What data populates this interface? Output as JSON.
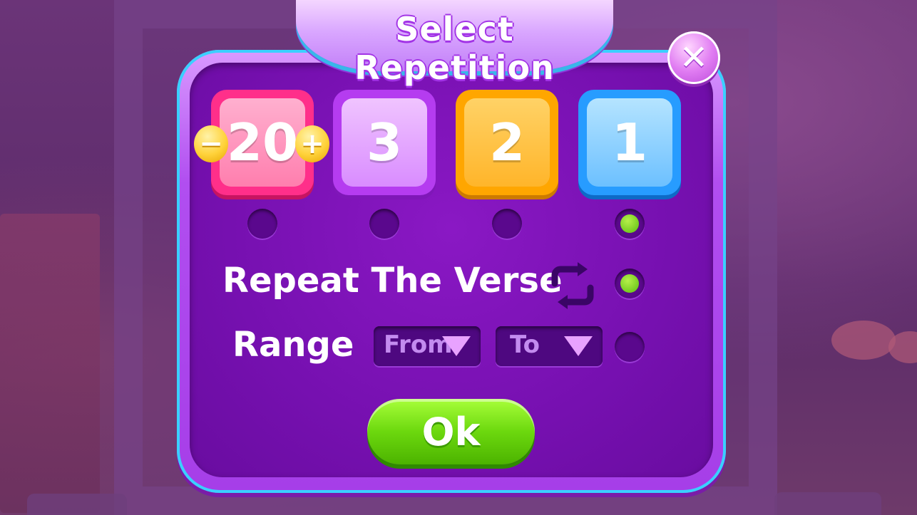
{
  "dialog": {
    "title": "Select Repetition",
    "close_symbol": "✕"
  },
  "repetitions": {
    "custom": {
      "value": "20",
      "minus": "−",
      "plus": "+"
    },
    "options": [
      "3",
      "2",
      "1"
    ],
    "selected": "1"
  },
  "repeat_verse": {
    "label": "Repeat The Verse",
    "icon": "repeat-icon",
    "checked": true
  },
  "range": {
    "label": "Range",
    "from_placeholder": "From",
    "to_placeholder": "To",
    "checked": false
  },
  "ok_label": "Ok",
  "colors": {
    "tile_pink": "#ff2f8a",
    "tile_purple": "#b53cf0",
    "tile_orange": "#ffa600",
    "tile_blue": "#279cff",
    "ok_green": "#6cd80e",
    "radio_on": "#5bbd10"
  }
}
